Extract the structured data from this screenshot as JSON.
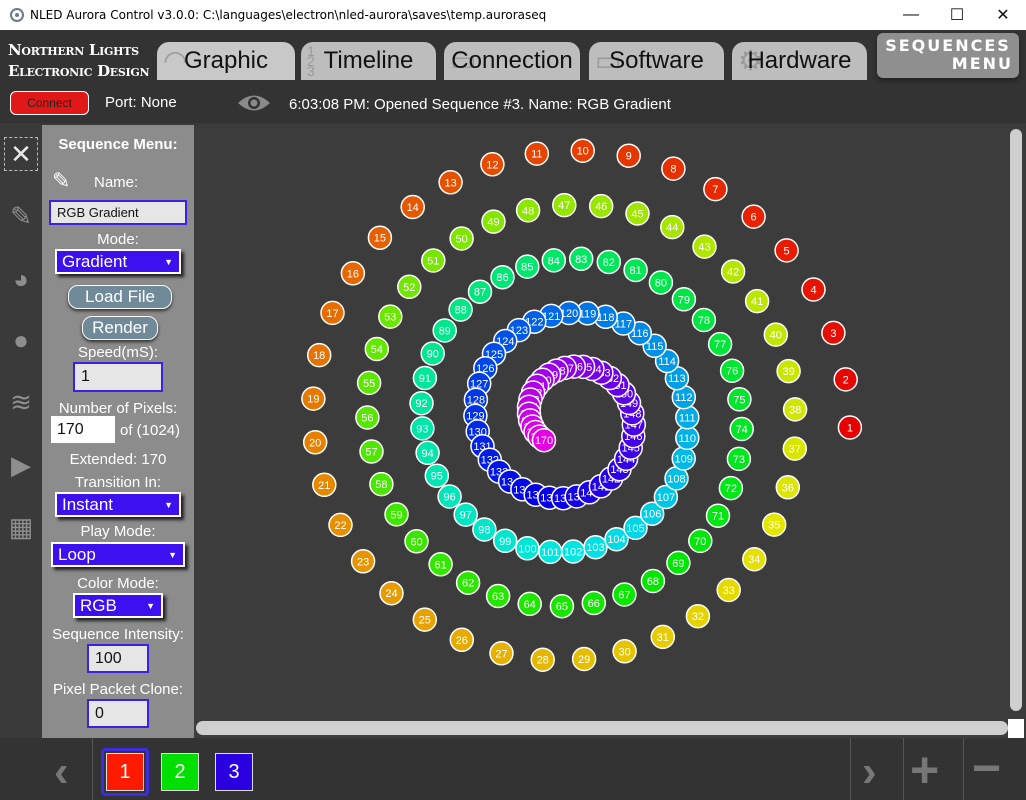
{
  "window": {
    "title": "NLED Aurora Control v3.0.0: C:\\languages\\electron\\nled-aurora\\saves\\temp.auroraseq",
    "minimize": "—",
    "maximize": "☐",
    "close": "✕"
  },
  "logo": {
    "line1": "Northern Lights",
    "line2": "Electronic Design"
  },
  "tabs": [
    {
      "label": "Graphic",
      "icon": "rainbow-icon"
    },
    {
      "label": "Timeline",
      "icon": "timeline-icon"
    },
    {
      "label": "Connection",
      "icon": "connection-icon"
    },
    {
      "label": "Software",
      "icon": "monitor-icon"
    },
    {
      "label": "Hardware",
      "icon": "gear-icon"
    }
  ],
  "sequences_menu": {
    "line1": "SEQUENCES",
    "line2": "MENU"
  },
  "status": {
    "connect_label": "Connect",
    "port": "Port: None",
    "message": "6:03:08 PM: Opened Sequence #3. Name: RGB Gradient"
  },
  "panel": {
    "heading": "Sequence Menu:",
    "name_label": "Name:",
    "name_value": "RGB Gradient",
    "mode_label": "Mode:",
    "mode_value": "Gradient",
    "load_file": "Load File",
    "render": "Render",
    "speed_label": "Speed(mS):",
    "speed_value": "1",
    "pixels_label": "Number of Pixels:",
    "pixels_value": "170",
    "pixels_max": "of (1024)",
    "extended": "Extended: 170",
    "transition_label": "Transition In:",
    "transition_value": "Instant",
    "playmode_label": "Play Mode:",
    "playmode_value": "Loop",
    "colormode_label": "Color Mode:",
    "colormode_value": "RGB",
    "intensity_label": "Sequence Intensity:",
    "intensity_value": "100",
    "clone_label": "Pixel Packet Clone:",
    "clone_value": "0"
  },
  "pixels": {
    "count": 170,
    "first": 1,
    "last": 170
  },
  "bottom": {
    "sequences": [
      {
        "label": "1",
        "color": "#ff1a00"
      },
      {
        "label": "2",
        "color": "#00e000"
      },
      {
        "label": "3",
        "color": "#2a00e0"
      }
    ],
    "selected": 1
  },
  "colors": {
    "accent": "#3d10f0",
    "connect": "#e01818"
  }
}
